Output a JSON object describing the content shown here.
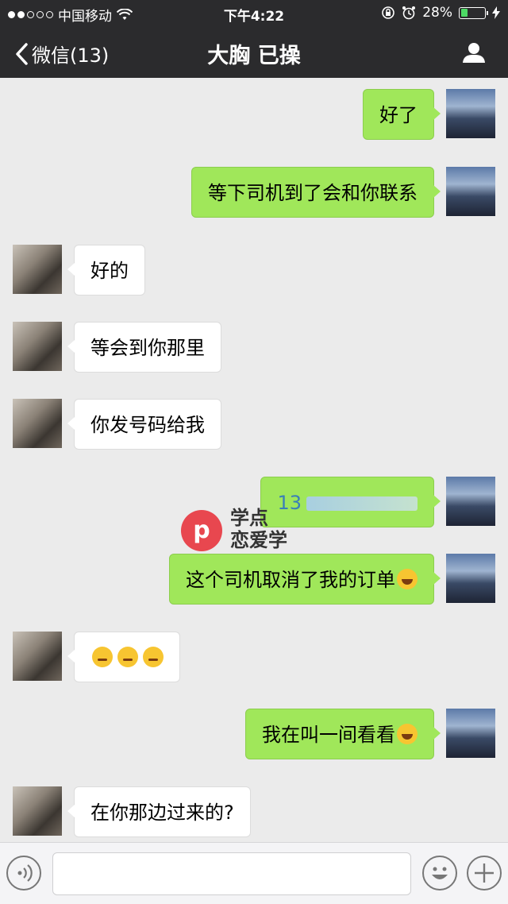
{
  "status_bar": {
    "carrier": "中国移动",
    "time": "下午4:22",
    "battery_percent": "28%",
    "battery_level": 0.28,
    "signal_bars_filled": 2,
    "signal_bars_total": 5
  },
  "nav": {
    "back_label": "微信(13)",
    "title": "大胸 已操"
  },
  "messages": [
    {
      "side": "right",
      "text": "好了"
    },
    {
      "side": "right",
      "text": "等下司机到了会和你联系"
    },
    {
      "side": "left",
      "text": "好的"
    },
    {
      "side": "left",
      "text": "等会到你那里"
    },
    {
      "side": "left",
      "text": "你发号码给我"
    },
    {
      "side": "right",
      "text": "13",
      "note": "phone number blurred"
    },
    {
      "side": "right",
      "text": "这个司机取消了我的订单",
      "emoji": "laugh-cry"
    },
    {
      "side": "left",
      "text": "",
      "emoji": "thinking x3"
    },
    {
      "side": "right",
      "text": "我在叫一间看看",
      "emoji": "laugh-cry"
    },
    {
      "side": "left",
      "text": "在你那边过来的?"
    }
  ],
  "watermark": {
    "line1": "学点",
    "line2": "恋爱学"
  },
  "colors": {
    "nav_bg": "#2b2b2d",
    "chat_bg": "#ebebeb",
    "sent_bubble": "#a0e75a",
    "received_bubble": "#ffffff",
    "battery": "#4cd964",
    "watermark_heart": "#e8474f"
  },
  "icons": {
    "back": "chevron-left-icon",
    "profile": "person-icon",
    "voice": "voice-icon",
    "emoji": "smiley-icon",
    "plus": "plus-icon"
  }
}
